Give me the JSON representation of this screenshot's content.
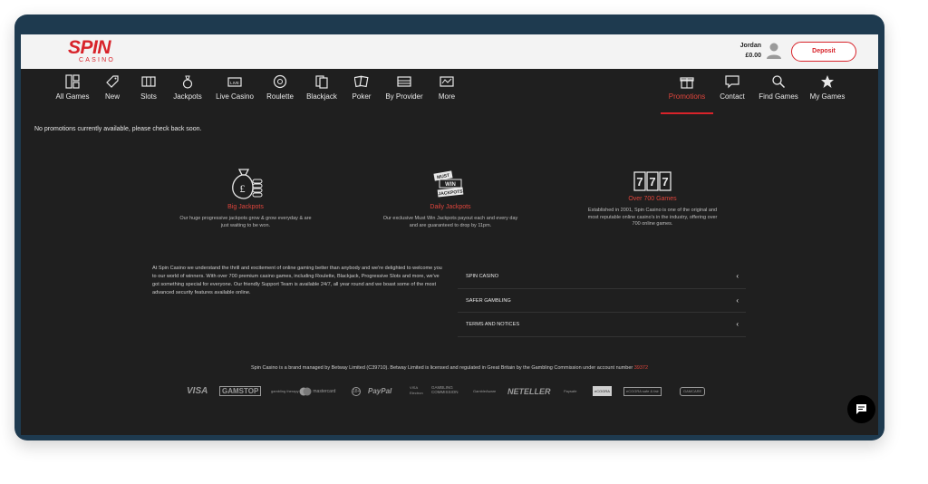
{
  "header": {
    "logo_main": "SPIN",
    "logo_sub": "CASINO",
    "user_name": "Jordan",
    "balance": "£0.00",
    "deposit_label": "Deposit"
  },
  "nav": {
    "items": [
      {
        "label": "All Games",
        "icon": "grid-icon"
      },
      {
        "label": "New",
        "icon": "tag-icon"
      },
      {
        "label": "Slots",
        "icon": "slots-icon"
      },
      {
        "label": "Jackpots",
        "icon": "money-bag-icon"
      },
      {
        "label": "Live Casino",
        "icon": "live-icon"
      },
      {
        "label": "Roulette",
        "icon": "roulette-icon"
      },
      {
        "label": "Blackjack",
        "icon": "cards-icon"
      },
      {
        "label": "Poker",
        "icon": "poker-icon"
      },
      {
        "label": "By Provider",
        "icon": "provider-icon"
      },
      {
        "label": "More",
        "icon": "more-icon"
      }
    ],
    "right_items": [
      {
        "label": "Promotions",
        "icon": "gift-icon",
        "active": true
      },
      {
        "label": "Contact",
        "icon": "chat-bubble-icon"
      },
      {
        "label": "Find Games",
        "icon": "search-icon"
      },
      {
        "label": "My Games",
        "icon": "star-icon"
      }
    ]
  },
  "main": {
    "notice": "No promotions currently available, please check back soon."
  },
  "features": [
    {
      "title": "Big Jackpots",
      "desc": "Our huge progressive jackpots grow & grow everyday & are just waiting to be won.",
      "icon": "money-bag-icon"
    },
    {
      "title": "Daily Jackpots",
      "desc": "Our exclusive Must Win Jackpots payout each and every day and are guaranteed to drop by 11pm.",
      "icon": "must-win-jackpots-icon",
      "badge_top": "MUST",
      "badge_mid": "WIN",
      "badge_bottom": "JACKPOTS"
    },
    {
      "title": "Over 700 Games",
      "desc": "Established in 2001, Spin Casino is one of the original and most reputable online casino's in the industry, offering over 700 online games.",
      "icon": "slot-777-icon",
      "digits": "777"
    }
  ],
  "footer": {
    "about": "At Spin Casino we understand the thrill and excitement of online gaming better than anybody and we're delighted to welcome you to our world of winners. With over 700 premium casino games, including Roulette, Blackjack, Progressive Slots and more, we've got something special for everyone. Our friendly Support Team is available 24/7, all year round and we boast some of the most advanced security features available online.",
    "accordion": [
      {
        "label": "SPIN CASINO"
      },
      {
        "label": "SAFER GAMBLING"
      },
      {
        "label": "TERMS AND NOTICES"
      }
    ],
    "license_text": "Spin Casino is a brand managed by Betway Limited (C39710). Betway Limited is licensed and regulated in Great Britain by the Gambling Commission under account number ",
    "license_number": "39372",
    "payment_logos": [
      "VISA",
      "GAMSTOP",
      "gambling therapy",
      "mastercard",
      "18+",
      "PayPal",
      "VISA Electron",
      "GAMBLING COMMISSION",
      "GambleAware",
      "NETELLER",
      "Paysafe",
      "eCOGRA",
      "eCOGRA safe & fair",
      "GAMCARE"
    ]
  },
  "colors": {
    "accent": "#d8232a",
    "background": "#1f1f1f",
    "frame": "#1e3a4f"
  }
}
